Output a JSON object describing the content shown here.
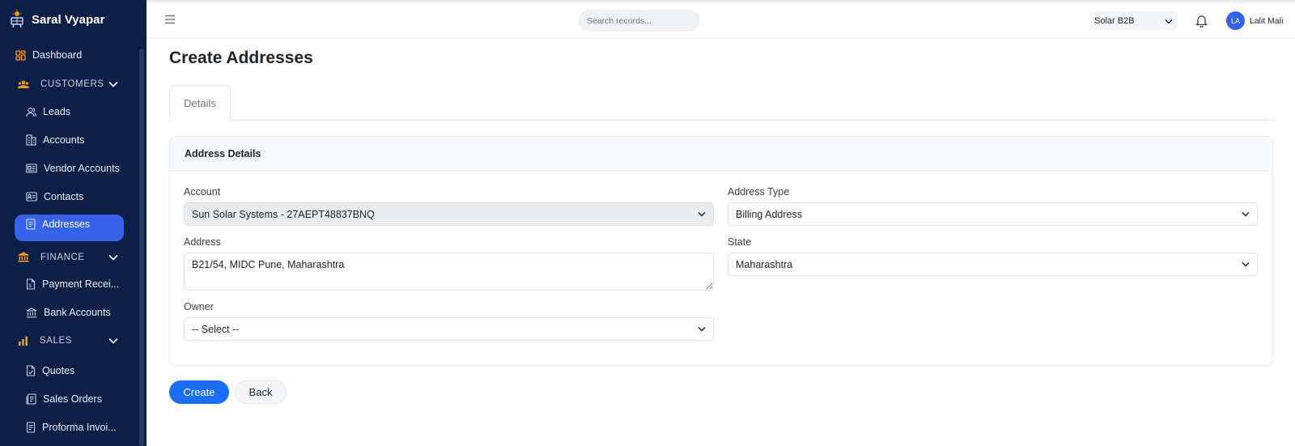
{
  "app": {
    "name": "Saral Vyapar"
  },
  "sidebar": {
    "dashboard": "Dashboard",
    "sections": [
      {
        "label": "CUSTOMERS",
        "items": [
          "Leads",
          "Accounts",
          "Vendor Accounts",
          "Contacts",
          "Addresses"
        ]
      },
      {
        "label": "FINANCE",
        "items": [
          "Payment Recei...",
          "Bank Accounts"
        ]
      },
      {
        "label": "SALES",
        "items": [
          "Quotes",
          "Sales Orders",
          "Proforma Invoi..."
        ]
      }
    ],
    "active_item": "Addresses"
  },
  "topbar": {
    "search_placeholder": "Search records...",
    "company": "Solar B2B",
    "user_initials": "LA",
    "user_name": "Lalit Mali"
  },
  "page": {
    "title": "Create Addresses",
    "tab": "Details",
    "card_title": "Address Details"
  },
  "form": {
    "account_label": "Account",
    "account_value": "Sun Solar Systems - 27AEPT48837BNQ",
    "address_type_label": "Address Type",
    "address_type_value": "Billing Address",
    "address_label": "Address",
    "address_value": "B21/54, MIDC Pune, Maharashtra",
    "state_label": "State",
    "state_value": "Maharashtra",
    "owner_label": "Owner",
    "owner_value": "-- Select --"
  },
  "actions": {
    "create": "Create",
    "back": "Back"
  },
  "colors": {
    "sidebar_bg": "#0b1f47",
    "accent": "#3562e6",
    "primary_button": "#1a6ef5",
    "section_icon": "#f29a1f"
  }
}
